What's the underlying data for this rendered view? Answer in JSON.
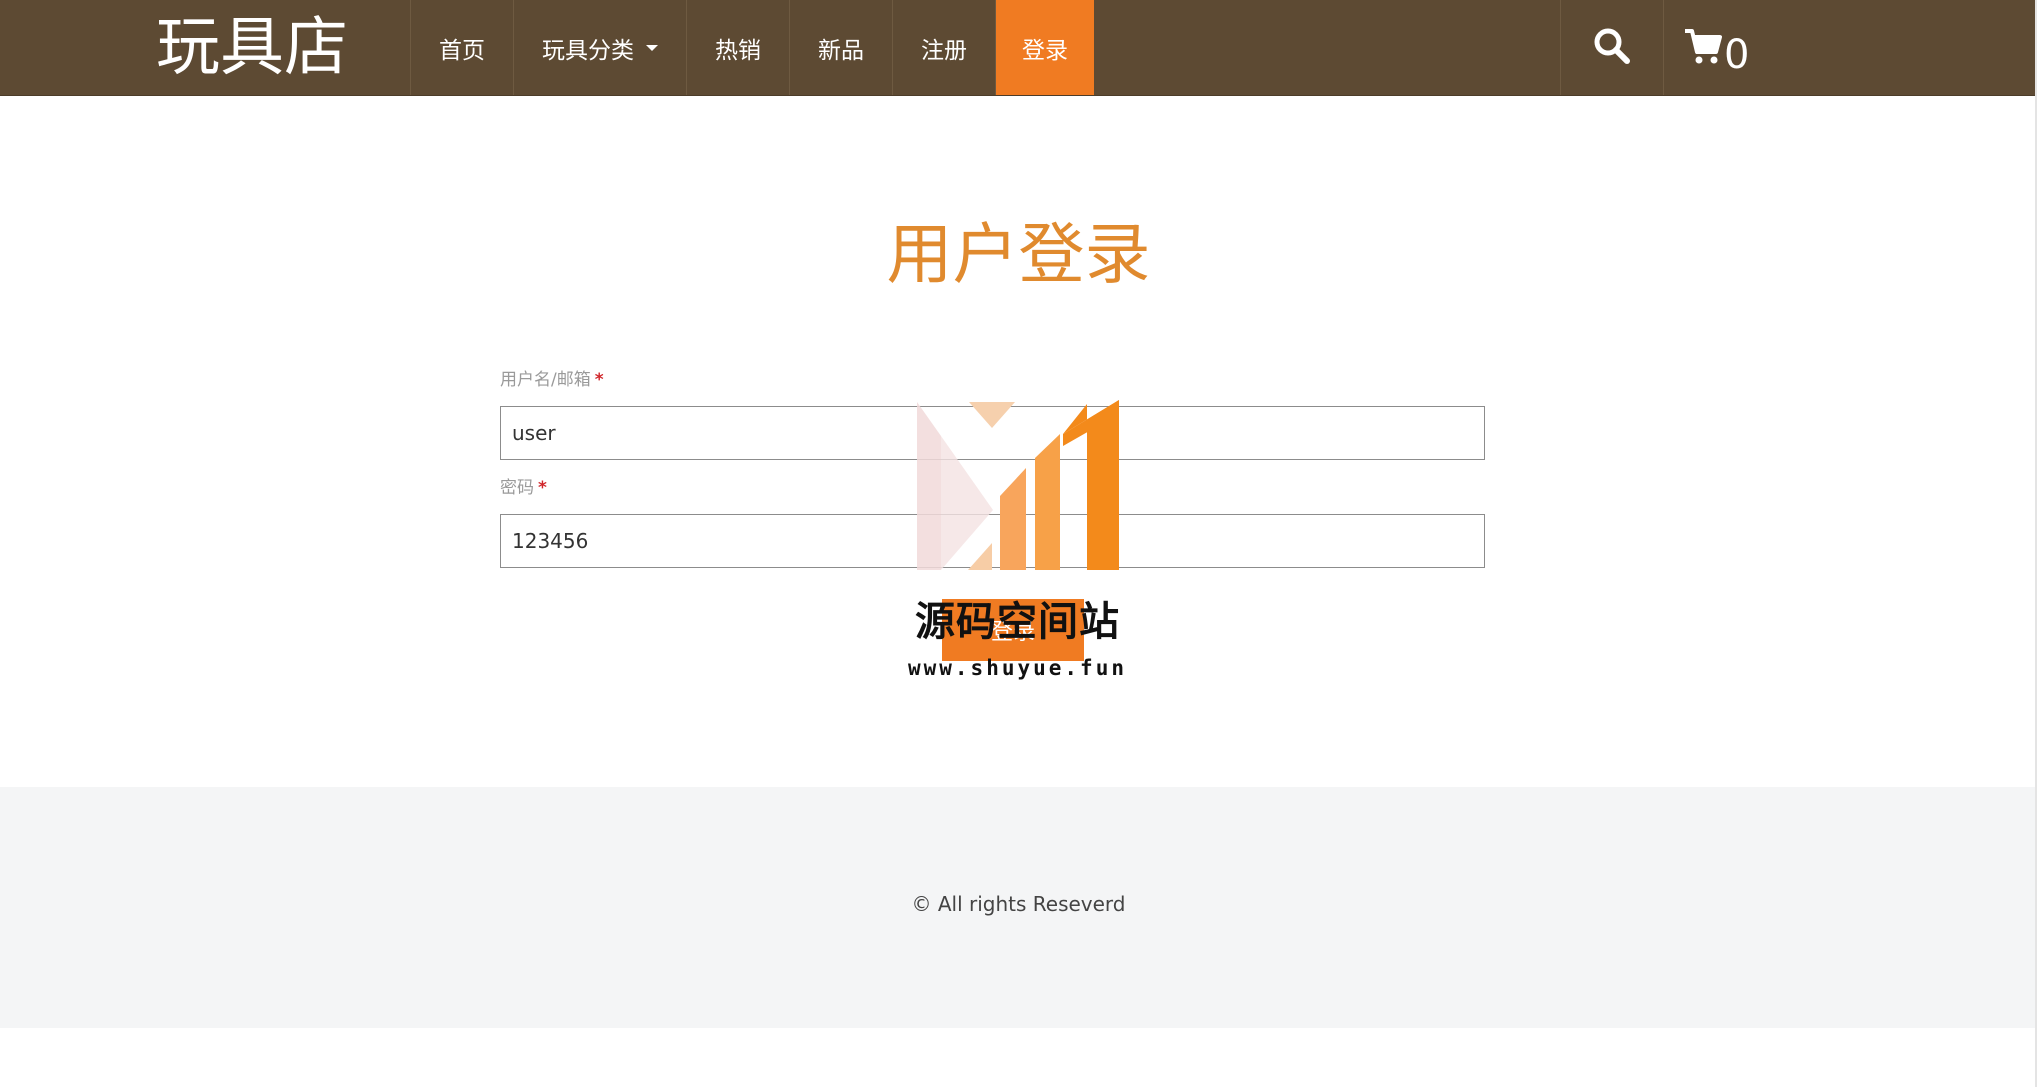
{
  "header": {
    "brand": "玩具店",
    "nav": {
      "home": "首页",
      "categories": "玩具分类",
      "hot": "热销",
      "new": "新品",
      "register": "注册",
      "login": "登录"
    },
    "icons": {
      "search": "search-icon",
      "cart": "cart-icon"
    },
    "cart_count": "0"
  },
  "main": {
    "title": "用户登录",
    "username": {
      "label": "用户名/邮箱",
      "required_mark": "*",
      "value": "user"
    },
    "password": {
      "label": "密码",
      "required_mark": "*",
      "value": "123456"
    },
    "submit_label": "登录"
  },
  "watermark": {
    "title": "源码空间站",
    "url": "www.shuyue.fun"
  },
  "footer": {
    "copyright": "© All rights Reseverd"
  },
  "colors": {
    "header_bg": "#5d4a33",
    "accent": "#f07b22",
    "title": "#e08a2e",
    "required": "#d0262b",
    "footer_bg": "#f4f5f6"
  }
}
